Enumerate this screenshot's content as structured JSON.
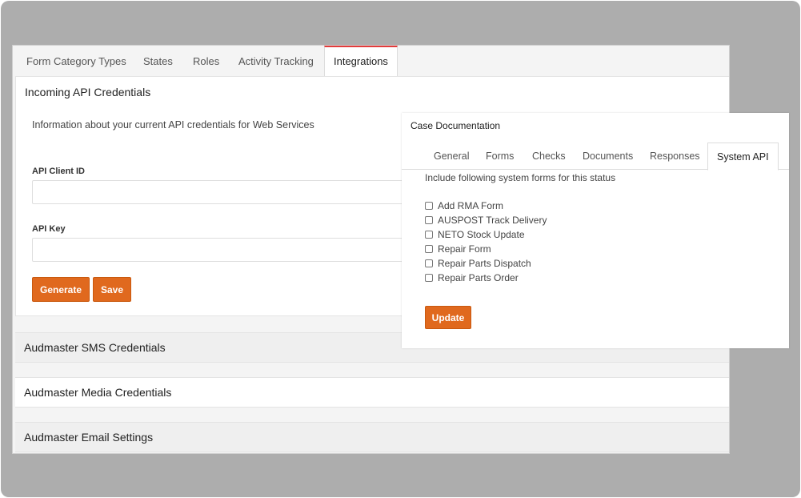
{
  "tabs": [
    {
      "label": "Form Category Types",
      "active": false
    },
    {
      "label": "States",
      "active": false
    },
    {
      "label": "Roles",
      "active": false
    },
    {
      "label": "Activity Tracking",
      "active": false
    },
    {
      "label": "Integrations",
      "active": true
    }
  ],
  "incoming": {
    "title": "Incoming API Credentials",
    "description": "Information about your current API credentials for Web Services",
    "client_id_label": "API Client ID",
    "client_id_value": "",
    "api_key_label": "API Key",
    "api_key_value": "",
    "generate_label": "Generate",
    "save_label": "Save"
  },
  "sections": [
    {
      "title": "Audmaster SMS Credentials"
    },
    {
      "title": "Audmaster Media Credentials"
    },
    {
      "title": "Audmaster Email Settings"
    }
  ],
  "overlay": {
    "title": "Case Documentation",
    "tabs": [
      {
        "label": "General",
        "active": false
      },
      {
        "label": "Forms",
        "active": false
      },
      {
        "label": "Checks",
        "active": false
      },
      {
        "label": "Documents",
        "active": false
      },
      {
        "label": "Responses",
        "active": false
      },
      {
        "label": "System API",
        "active": true
      }
    ],
    "subtitle": "Include following system forms for this status",
    "forms": [
      {
        "label": "Add RMA Form",
        "checked": false
      },
      {
        "label": "AUSPOST Track Delivery",
        "checked": false
      },
      {
        "label": "NETO Stock Update",
        "checked": false
      },
      {
        "label": "Repair Form",
        "checked": false
      },
      {
        "label": "Repair Parts Dispatch",
        "checked": false
      },
      {
        "label": "Repair Parts Order",
        "checked": false
      }
    ],
    "update_label": "Update"
  },
  "colors": {
    "accent_button": "#e0691e",
    "active_tab_border": "#e33b3b",
    "backdrop": "#adadad"
  }
}
